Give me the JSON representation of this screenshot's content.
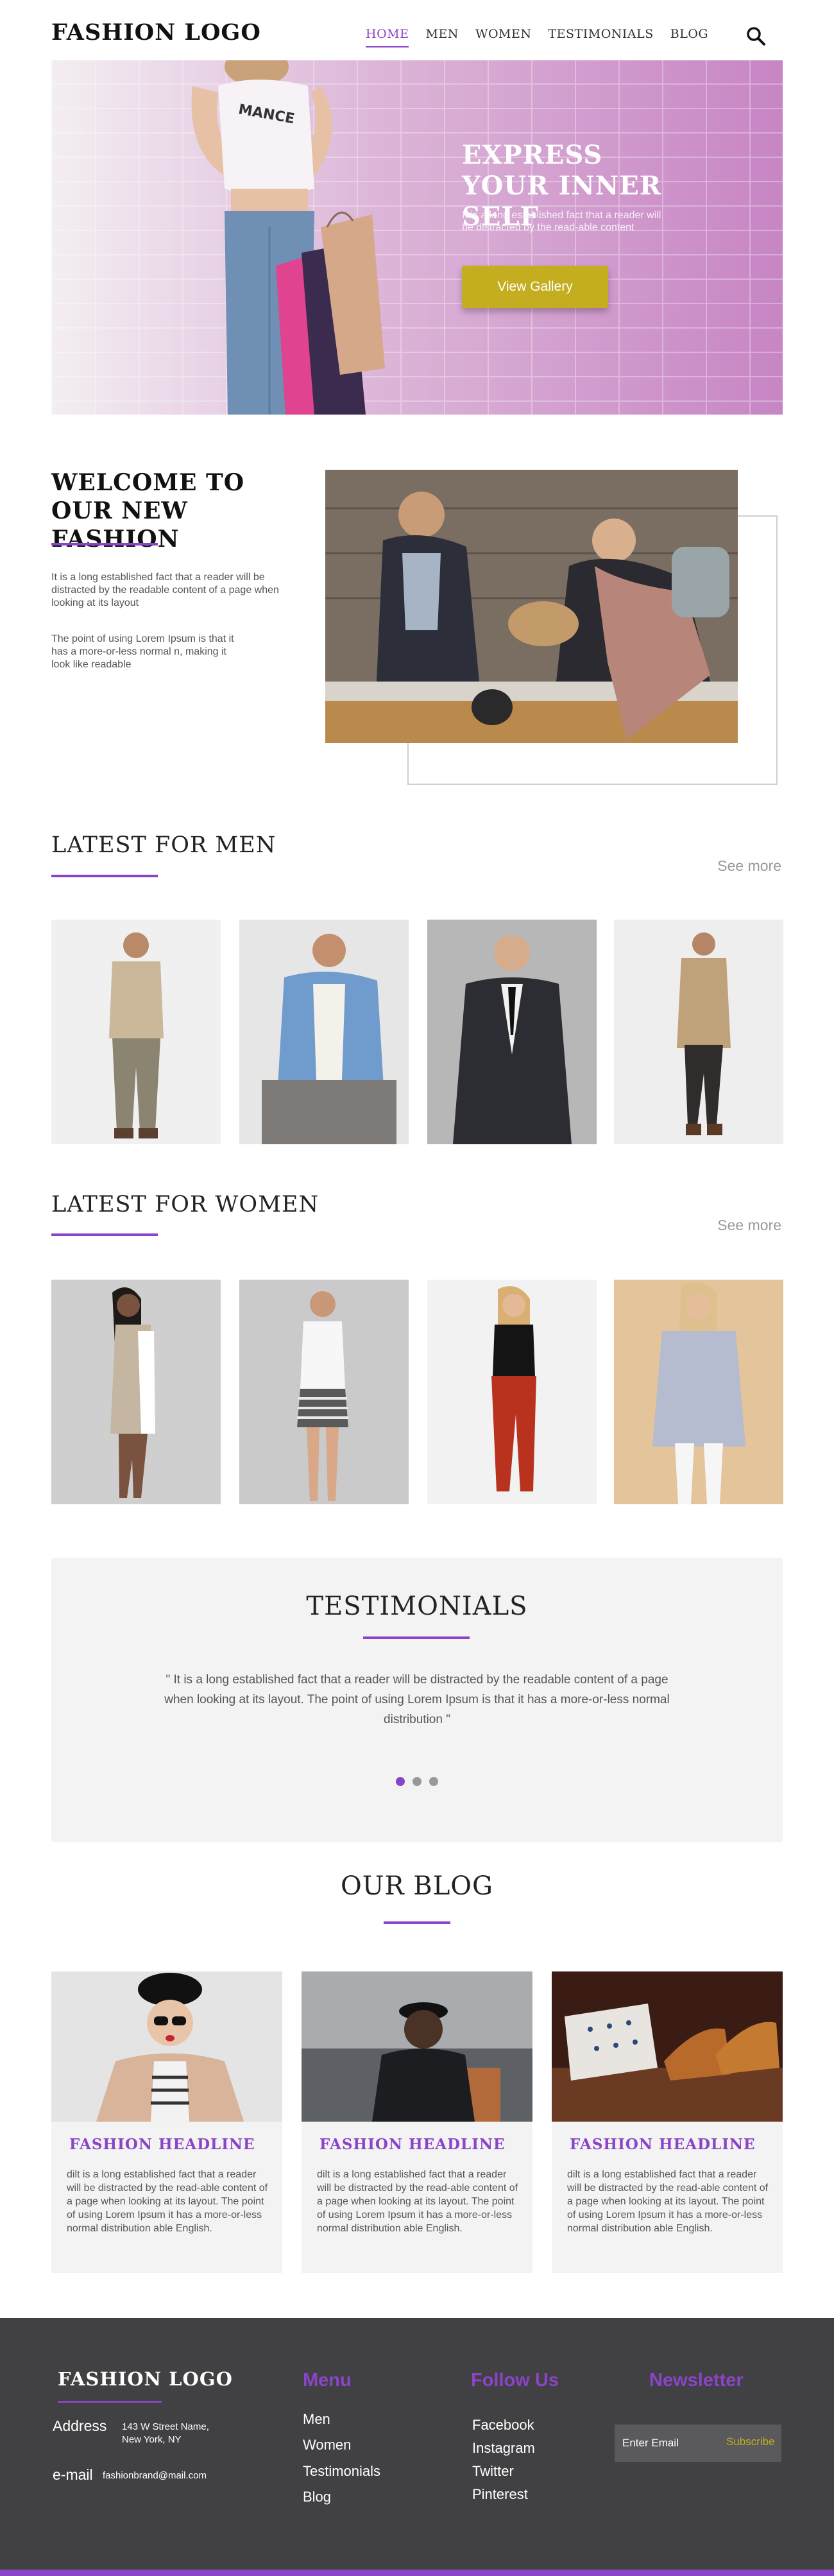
{
  "header": {
    "logo": "FASHION LOGO",
    "nav": [
      "HOME",
      "MEN",
      "WOMEN",
      "TESTIMONIALS",
      "BLOG"
    ],
    "active_nav": "HOME",
    "search_icon": "search-icon"
  },
  "hero": {
    "title": "EXPRESS YOUR INNER SELF",
    "text": "It is a long established fact that a reader will be distracted by the read-able content",
    "button": "View Gallery",
    "shirt_text": "MANCE"
  },
  "welcome": {
    "title": "WELCOME TO OUR NEW FASHION",
    "p1": "It is a long established fact that a reader will be distracted by the readable content of a page when looking at its layout",
    "p2": "The point of using Lorem Ipsum is that it has a more-or-less normal n, making it look like readable"
  },
  "men": {
    "title": "LATEST FOR MEN",
    "see_more": "See more"
  },
  "women": {
    "title": "LATEST FOR WOMEN",
    "see_more": "See more"
  },
  "testimonials": {
    "title": "TESTIMONIALS",
    "quote": "\" It is a long established fact that a reader will be distracted by the readable content of a page when looking at its layout. The point of using Lorem Ipsum is that it has a more-or-less normal distribution \"",
    "active_dot": 0
  },
  "blog": {
    "title": "OUR BLOG",
    "posts": [
      {
        "headline": "FASHION HEADLINE",
        "text": "dilt is a long established fact that a reader will be distracted by the read-able content of a page when looking at its layout. The point of using Lorem Ipsum it has a more-or-less normal distribution able English."
      },
      {
        "headline": "FASHION HEADLINE",
        "text": "dilt is a long established fact that a reader will be distracted by the read-able content of a page when looking at its layout. The point of using Lorem Ipsum it has a more-or-less normal distribution able English."
      },
      {
        "headline": "FASHION HEADLINE",
        "text": "dilt is a long established fact that a reader will be distracted by the read-able content of a page when looking at its layout. The point of using Lorem Ipsum it has a more-or-less normal distribution able English."
      }
    ]
  },
  "footer": {
    "logo": "FASHION LOGO",
    "address_label": "Address",
    "address_line1": "143 W Street Name,",
    "address_line2": "New York, NY",
    "email_label": "e-mail",
    "email": "fashionbrand@mail.com",
    "menu_title": "Menu",
    "menu": [
      "Men",
      "Women",
      "Testimonials",
      "Blog"
    ],
    "follow_title": "Follow Us",
    "follow": [
      "Facebook",
      "Instagram",
      "Twitter",
      "Pinterest"
    ],
    "newsletter_title": "Newsletter",
    "email_placeholder": "Enter Email",
    "subscribe": "Subscribe"
  },
  "colors": {
    "accent": "#8b44c8",
    "button": "#c4ad1f",
    "footer": "#414042"
  }
}
